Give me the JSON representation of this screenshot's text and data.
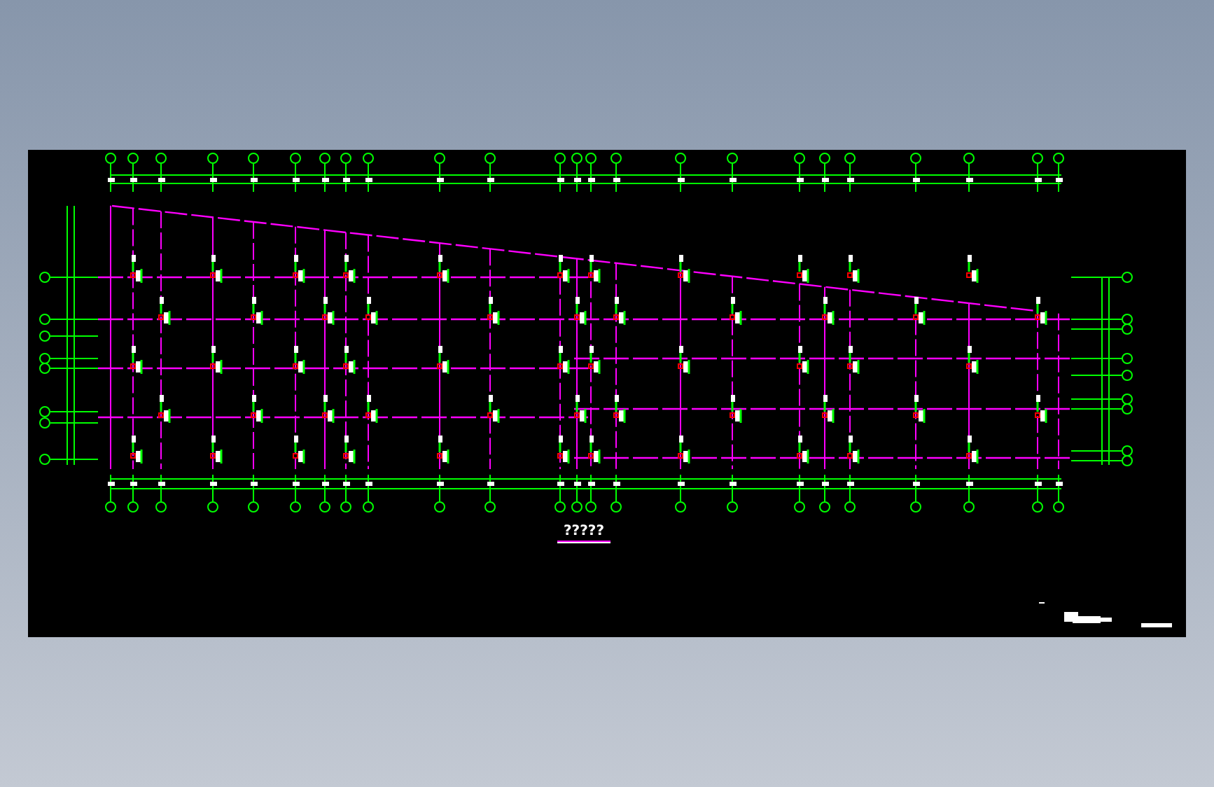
{
  "drawing": {
    "title": "?????"
  }
}
